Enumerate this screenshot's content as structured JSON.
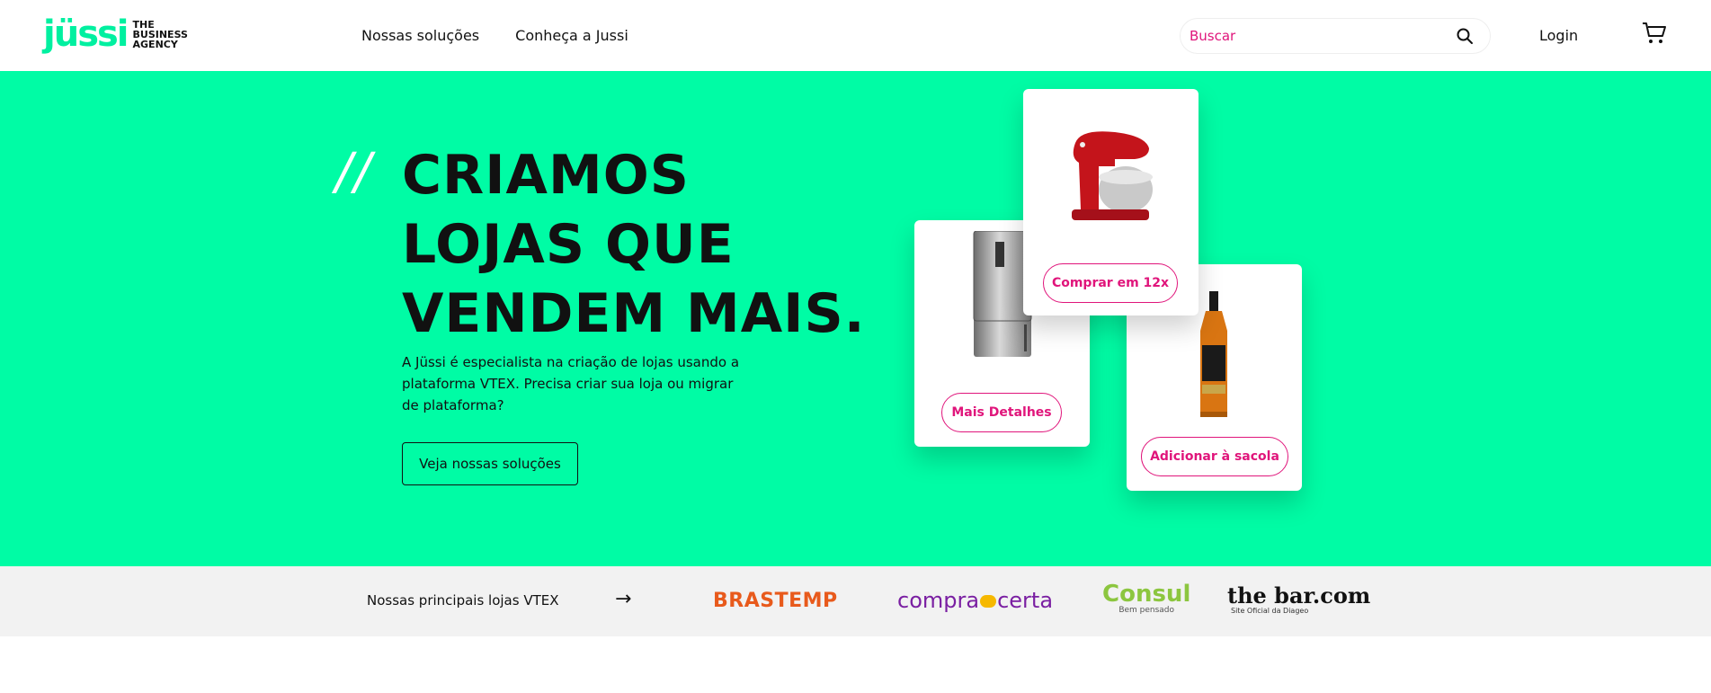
{
  "logo": {
    "mark": "jüssi",
    "tag_line1": "THE",
    "tag_line2": "BUSINESS",
    "tag_line3": "AGENCY"
  },
  "nav": {
    "items": [
      {
        "label": "Nossas soluções"
      },
      {
        "label": "Conheça a Jussi"
      }
    ]
  },
  "search": {
    "placeholder": "Buscar"
  },
  "header": {
    "login_label": "Login"
  },
  "hero": {
    "slashes": "//",
    "headline": [
      "CRIAMOS",
      "LOJAS QUE",
      "VENDEM MAIS."
    ],
    "subtext": "A Jüssi é especialista na criação de lojas usando a plataforma VTEX. Precisa criar sua loja ou migrar de plataforma?",
    "cta_label": "Veja nossas soluções"
  },
  "cards": {
    "fridge_button": "Mais Detalhes",
    "mixer_button": "Comprar em 12x",
    "bottle_button": "Adicionar à sacola"
  },
  "strip": {
    "title": "Nossas principais lojas VTEX",
    "arrow": "→",
    "brands": {
      "brastemp": "BRASTEMP",
      "compra_part1": "compra",
      "compra_part2": "certa",
      "consul": "Consul",
      "consul_sub": "Bem pensado",
      "bar": "the bar.com",
      "bar_sub": "Site Oficial da Diageo"
    }
  },
  "colors": {
    "accent_green": "#00fca5",
    "pink": "#e0157b",
    "strip_bg": "#f2f2f2"
  }
}
